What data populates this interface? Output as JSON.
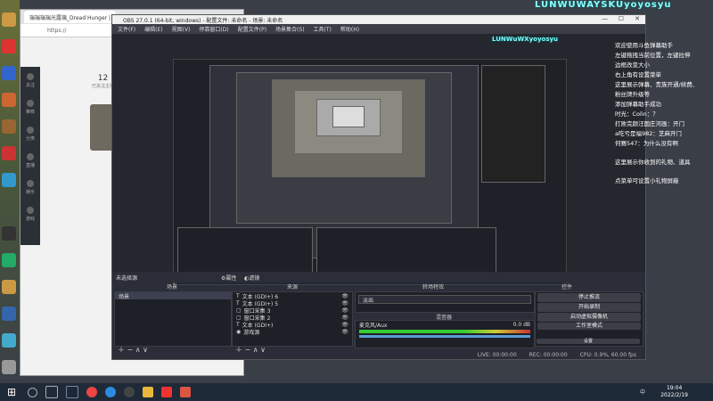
{
  "overlay": {
    "streamer_name": "LUNWUWAYSKUyoyosyu",
    "streamer_name_small": "LUNWuWXyoyosyu"
  },
  "browser": {
    "tab_title": "瑞瑞瑞瑞光露璃_Dread Hunger |",
    "address": "https://",
    "side_items": [
      "关注",
      "推荐",
      "分类",
      "直播",
      "娱乐",
      "游戏"
    ],
    "count": "12",
    "count_label": "已关注主播"
  },
  "obs": {
    "window_title": "OBS 27.0.1 (64-bit, windows) - 配置文件: 未命名 - 场景: 未命名",
    "menu": [
      "文件(F)",
      "编辑(E)",
      "视图(V)",
      "停靠窗口(D)",
      "配置文件(P)",
      "场景集合(S)",
      "工具(T)",
      "帮助(H)"
    ],
    "no_source": "未选择源",
    "properties_btn": "属性",
    "filters_btn": "滤镜",
    "docks": {
      "scenes": "场景",
      "sources": "来源",
      "transitions": "转场特效",
      "mixer": "混音器",
      "controls": "控件"
    },
    "scene_items": [
      "场景"
    ],
    "source_items": [
      {
        "icon": "T",
        "label": "文本 (GDI+) 6"
      },
      {
        "icon": "T",
        "label": "文本 (GDI+) 5"
      },
      {
        "icon": "▢",
        "label": "窗口采集 3"
      },
      {
        "icon": "▢",
        "label": "窗口采集 2"
      },
      {
        "icon": "T",
        "label": "文本 (GDI+)"
      },
      {
        "icon": "◉",
        "label": "游戏源"
      }
    ],
    "transition_value": "淡出",
    "mixer_channel": "麦克风/Aux",
    "mixer_db": "0.0 dB",
    "controls": [
      "停止推流",
      "开始录制",
      "启动虚拟摄像机",
      "工作室模式",
      "设置",
      "退出"
    ],
    "status": {
      "live": "LIVE: 00:00:00",
      "rec": "REC: 00:00:00",
      "cpu": "CPU: 0.9%, 60.00 fps"
    },
    "tools": "＋ − ∧ ∨"
  },
  "chat": {
    "lines": [
      "欢迎使用斗鱼弹幕助手",
      "左键拖拽当前位置，左键拉伸",
      "边框改变大小",
      "右上角有设置菜单",
      "这里展示弹幕、贵族开通/续费、",
      "粉丝牌升级等",
      "添加弹幕助手成功",
      "时光：Colin：？",
      "打败完颜汪国庄河画：开门",
      "a吃亏是福982：芝麻开门",
      "何赛547：为什么没有啊"
    ],
    "lines2": [
      "这里展示你收到的礼物、道具",
      "点菜单可设置小礼物屏蔽"
    ]
  },
  "taskbar": {
    "time": "19:04",
    "date": "2022/2/19",
    "lang": "中",
    "icons": [
      "search",
      "task-view",
      "steam",
      "browser",
      "edge",
      "obs",
      "files",
      "music",
      "app"
    ]
  },
  "colors": {
    "taskbar": "#1f2a38",
    "obs_bg": "#2b2e38",
    "accent": "#8ff"
  }
}
